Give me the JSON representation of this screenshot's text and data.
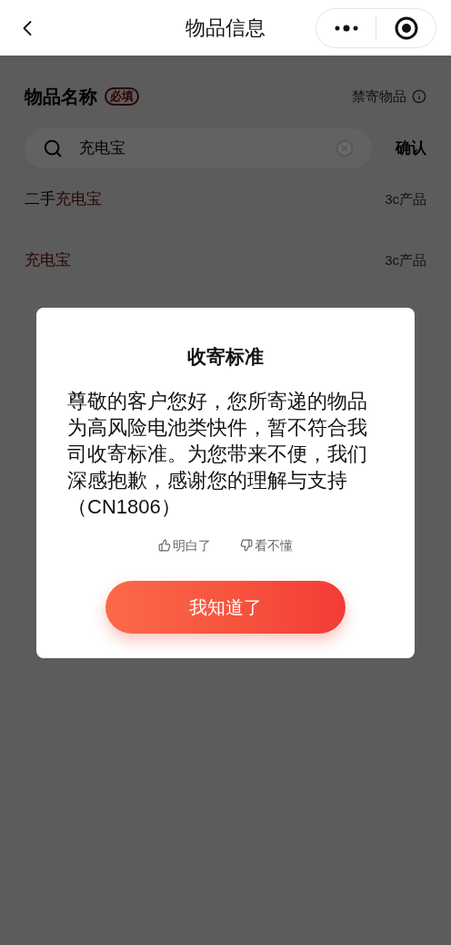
{
  "nav": {
    "title": "物品信息"
  },
  "section": {
    "title": "物品名称",
    "badge": "必填",
    "link": "禁寄物品"
  },
  "search": {
    "value": "充电宝",
    "confirm": "确认"
  },
  "suggestions": [
    {
      "prefix": "二手",
      "match": "充电宝",
      "category": "3c产品"
    },
    {
      "match": "充电宝",
      "category": "3c产品"
    }
  ],
  "dialog": {
    "title": "收寄标准",
    "message": "尊敬的客户您好，您所寄递的物品为高风险电池类快件，暂不符合我司收寄标准。为您带来不便，我们深感抱歉，感谢您的理解与支持（CN1806）",
    "feedback": [
      {
        "kind": "up",
        "label": "明白了"
      },
      {
        "kind": "down",
        "label": "看不懂"
      }
    ],
    "button": "我知道了"
  }
}
